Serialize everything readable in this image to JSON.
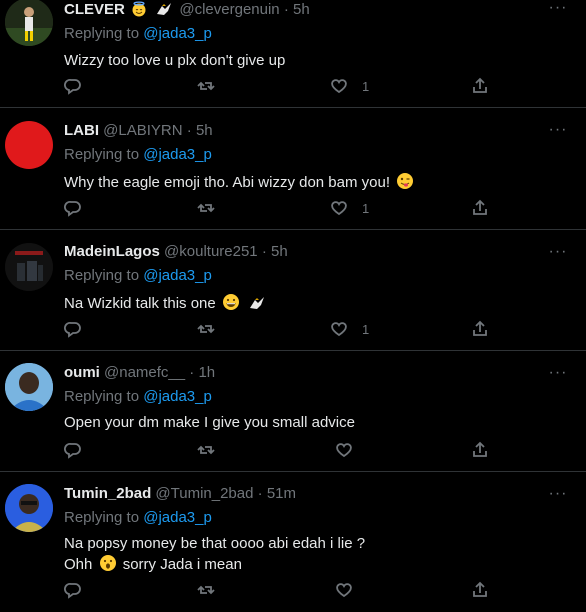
{
  "tweets": [
    {
      "name": "CLEVER",
      "handle": "@clevergenuin",
      "dot": "·",
      "time": "5h",
      "replying_prefix": "Replying to",
      "replying_to": "@jada3_p",
      "text": "Wizzy  too love u plx don't give up",
      "like_count": "1",
      "avatar_icon": "person-photo-icon"
    },
    {
      "name": "LABI",
      "handle": "@LABIYRN",
      "dot": "·",
      "time": "5h",
      "replying_prefix": "Replying to",
      "replying_to": "@jada3_p",
      "text": "Why the eagle emoji tho. Abi wizzy don bam you!",
      "like_count": "1",
      "avatar_color": "#e0191b"
    },
    {
      "name": "MadeinLagos",
      "handle": "@koulture251",
      "dot": "·",
      "time": "5h",
      "replying_prefix": "Replying to",
      "replying_to": "@jada3_p",
      "text": "Na Wizkid talk this one",
      "like_count": "1"
    },
    {
      "name": "oumi",
      "handle": "@namefc__",
      "dot": "·",
      "time": "1h",
      "replying_prefix": "Replying to",
      "replying_to": "@jada3_p",
      "text": "Open your dm make I give you small advice",
      "like_count": ""
    },
    {
      "name": "Tumin_2bad",
      "handle": "@Tumin_2bad",
      "dot": "·",
      "time": "51m",
      "replying_prefix": "Replying to",
      "replying_to": "@jada3_p",
      "text_line1": "Na popsy money be that oooo abi edah i lie ?",
      "text_line2_a": "Ohh",
      "text_line2_b": "sorry Jada i mean",
      "like_count": ""
    }
  ],
  "icons": {
    "reply": "reply-icon",
    "retweet": "retweet-icon",
    "like": "heart-icon",
    "share": "share-icon",
    "more": "more-icon"
  },
  "more_label": "···"
}
